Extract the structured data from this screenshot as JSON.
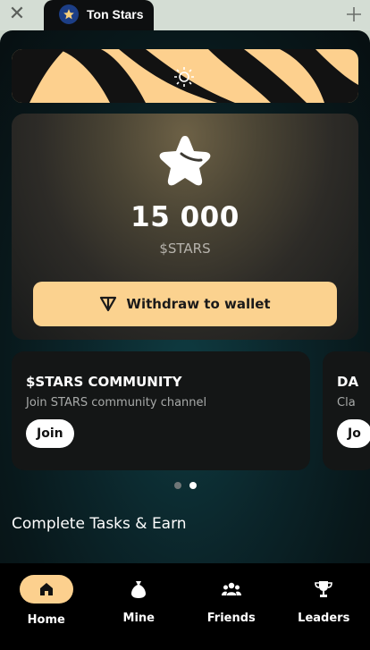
{
  "window": {
    "close_icon": "close-icon",
    "tab_title": "Ton Stars",
    "tab_icon": "star-logo-icon",
    "pin_icon": "pin-icon"
  },
  "banner": {
    "background_color": "#fdd08e",
    "icon": "sun-icon"
  },
  "balance": {
    "icon": "star-icon",
    "amount": "15 000",
    "currency": "$STARS",
    "withdraw_label": "Withdraw to wallet",
    "withdraw_icon": "ton-icon",
    "accent_color": "#fbd28f"
  },
  "cards": [
    {
      "title": "$STARS COMMUNITY",
      "subtitle": "Join STARS community channel",
      "button": "Join"
    },
    {
      "title": "DA",
      "subtitle": "Cla",
      "button": "Jo"
    }
  ],
  "carousel": {
    "pages": 2,
    "active_index": 1
  },
  "section_title": "Complete Tasks & Earn",
  "nav": [
    {
      "label": "Home",
      "icon": "home-icon",
      "active": true
    },
    {
      "label": "Mine",
      "icon": "bag-icon",
      "active": false
    },
    {
      "label": "Friends",
      "icon": "friends-icon",
      "active": false
    },
    {
      "label": "Leaders",
      "icon": "trophy-icon",
      "active": false
    }
  ]
}
